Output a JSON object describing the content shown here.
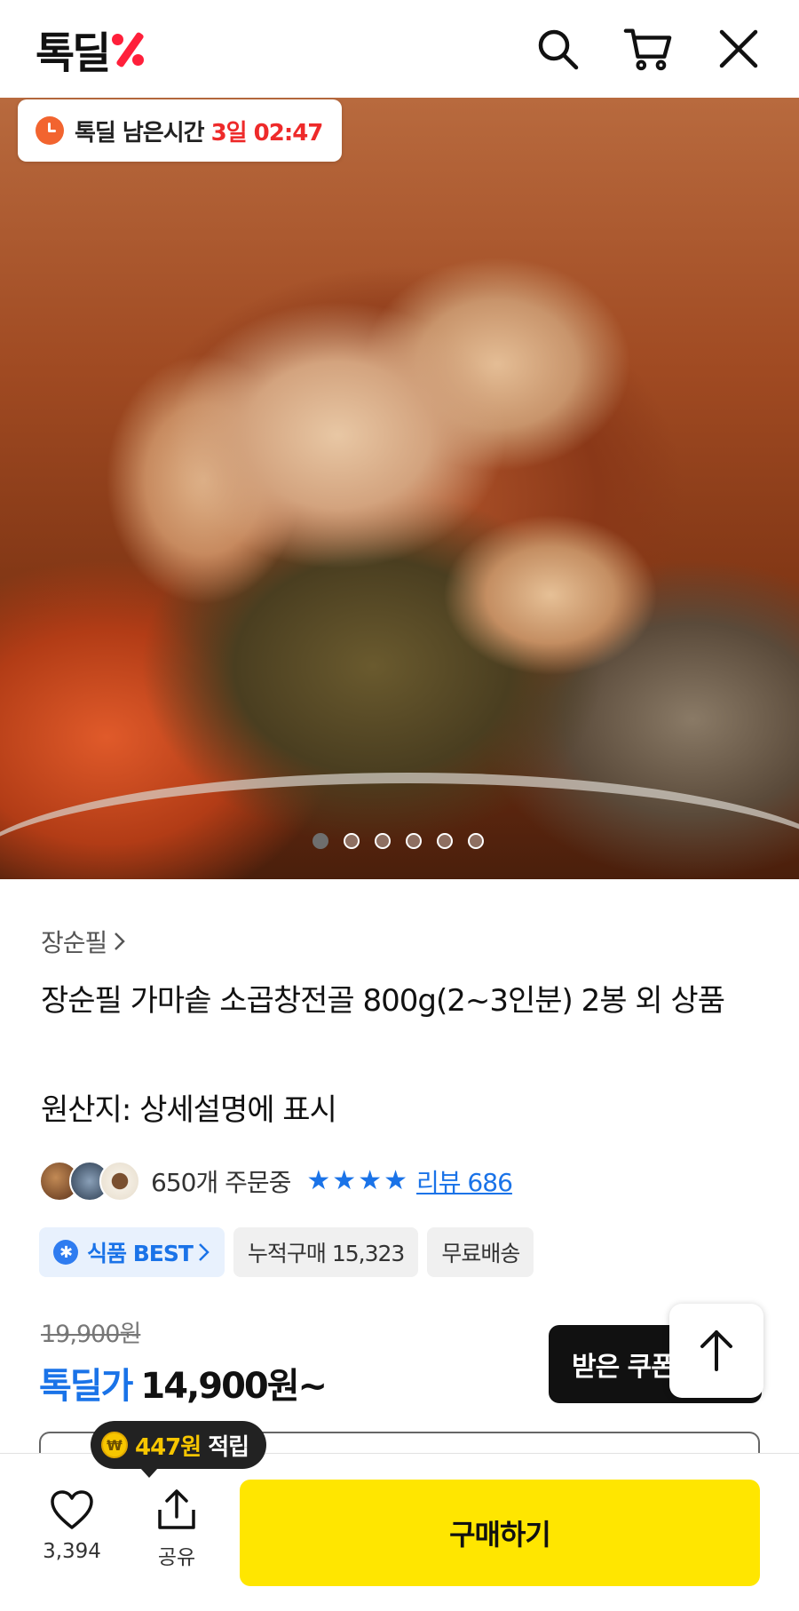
{
  "header": {
    "logo_text": "톡딜",
    "logo_symbol": "%",
    "icons": [
      "search-icon",
      "cart-icon",
      "close-icon"
    ]
  },
  "hero": {
    "timer_label": "톡딜 남은시간",
    "timer_value": "3일 02:47",
    "image_count": 6,
    "active_index": 0
  },
  "product": {
    "brand": "장순필",
    "title": "장순필 가마솥 소곱창전골 800g(2~3인분) 2봉 외 상품",
    "origin": "원산지: 상세설명에 표시",
    "order_count": "650개 주문중",
    "rating_stars": 4,
    "review_label": "리뷰 686",
    "chips": {
      "best": "식품 BEST",
      "cumulative": "누적구매 15,323",
      "shipping": "무료배송"
    },
    "original_price": "19,900원",
    "deal_label": "톡딜가",
    "deal_price": "14,900원~",
    "coupon_button": "받은 쿠폰"
  },
  "bottom": {
    "reward_amount": "447원",
    "reward_label": "적립",
    "coin_symbol": "₩",
    "like_count": "3,394",
    "share_label": "공유",
    "buy_label": "구매하기"
  },
  "colors": {
    "accent_blue": "#1a73e8",
    "logo_red": "#ff1f3a",
    "timer_red": "#ee2a2a",
    "buy_yellow": "#ffe600"
  }
}
